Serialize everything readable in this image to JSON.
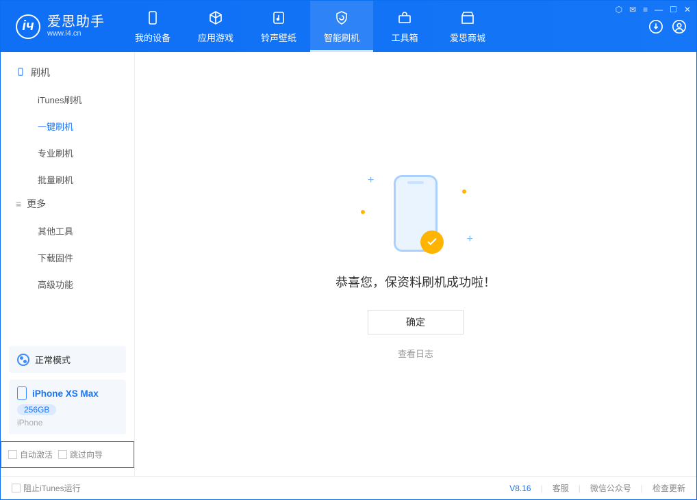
{
  "app": {
    "title": "爱思助手",
    "subtext": "www.i4.cn"
  },
  "tabs": [
    {
      "label": "我的设备"
    },
    {
      "label": "应用游戏"
    },
    {
      "label": "铃声壁纸"
    },
    {
      "label": "智能刷机"
    },
    {
      "label": "工具箱"
    },
    {
      "label": "爱思商城"
    }
  ],
  "sidebar": {
    "section1_title": "刷机",
    "items1": [
      {
        "label": "iTunes刷机"
      },
      {
        "label": "一键刷机"
      },
      {
        "label": "专业刷机"
      },
      {
        "label": "批量刷机"
      }
    ],
    "section2_title": "更多",
    "items2": [
      {
        "label": "其他工具"
      },
      {
        "label": "下载固件"
      },
      {
        "label": "高级功能"
      }
    ],
    "mode_label": "正常模式",
    "device": {
      "name": "iPhone XS Max",
      "capacity": "256GB",
      "type": "iPhone"
    },
    "option_auto_activate": "自动激活",
    "option_skip_wizard": "跳过向导"
  },
  "main": {
    "success_message": "恭喜您，保资料刷机成功啦！",
    "ok_button": "确定",
    "view_log": "查看日志"
  },
  "footer": {
    "block_itunes": "阻止iTunes运行",
    "version": "V8.16",
    "support": "客服",
    "wechat": "微信公众号",
    "check_update": "检查更新"
  }
}
